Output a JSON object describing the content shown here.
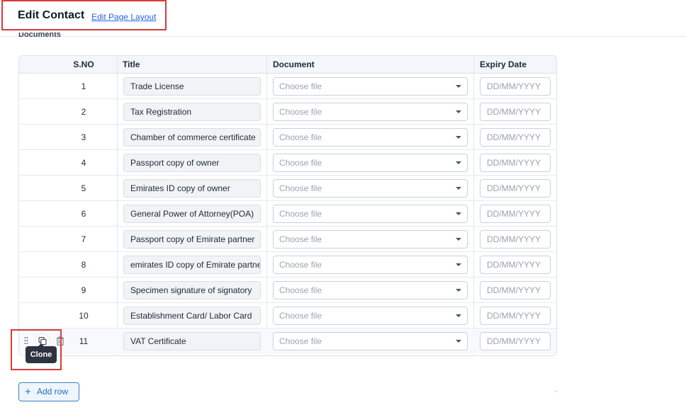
{
  "header": {
    "title": "Edit Contact",
    "edit_layout_link": "Edit Page Layout"
  },
  "section": {
    "label": "Documents"
  },
  "table": {
    "columns": {
      "sno": "S.NO",
      "title": "Title",
      "document": "Document",
      "expiry": "Expiry Date"
    },
    "rows": [
      {
        "sno": "1",
        "title": "Trade License",
        "document_placeholder": "Choose file",
        "expiry_placeholder": "DD/MM/YYYY"
      },
      {
        "sno": "2",
        "title": "Tax Registration",
        "document_placeholder": "Choose file",
        "expiry_placeholder": "DD/MM/YYYY"
      },
      {
        "sno": "3",
        "title": "Chamber of commerce certificate",
        "document_placeholder": "Choose file",
        "expiry_placeholder": "DD/MM/YYYY"
      },
      {
        "sno": "4",
        "title": "Passport copy of owner",
        "document_placeholder": "Choose file",
        "expiry_placeholder": "DD/MM/YYYY"
      },
      {
        "sno": "5",
        "title": "Emirates ID copy of owner",
        "document_placeholder": "Choose file",
        "expiry_placeholder": "DD/MM/YYYY"
      },
      {
        "sno": "6",
        "title": "General Power of Attorney(POA)",
        "document_placeholder": "Choose file",
        "expiry_placeholder": "DD/MM/YYYY"
      },
      {
        "sno": "7",
        "title": "Passport copy of Emirate partner",
        "document_placeholder": "Choose file",
        "expiry_placeholder": "DD/MM/YYYY"
      },
      {
        "sno": "8",
        "title": "emirates ID copy of Emirate partner",
        "document_placeholder": "Choose file",
        "expiry_placeholder": "DD/MM/YYYY"
      },
      {
        "sno": "9",
        "title": "Specimen signature of signatory",
        "document_placeholder": "Choose file",
        "expiry_placeholder": "DD/MM/YYYY"
      },
      {
        "sno": "10",
        "title": "Establishment Card/ Labor Card",
        "document_placeholder": "Choose file",
        "expiry_placeholder": "DD/MM/YYYY"
      },
      {
        "sno": "11",
        "title": "VAT Certificate",
        "document_placeholder": "Choose file",
        "expiry_placeholder": "DD/MM/YYYY"
      }
    ]
  },
  "row_actions": {
    "icons": [
      "drag-handle-icon",
      "clone-icon",
      "trash-icon"
    ],
    "clone_tooltip": "Clone"
  },
  "footer": {
    "add_row_label": "Add row",
    "add_row_icon": "+"
  },
  "colors": {
    "accent": "#2563eb",
    "highlight": "#d83a3a",
    "tooltip_bg": "#2d3340"
  }
}
